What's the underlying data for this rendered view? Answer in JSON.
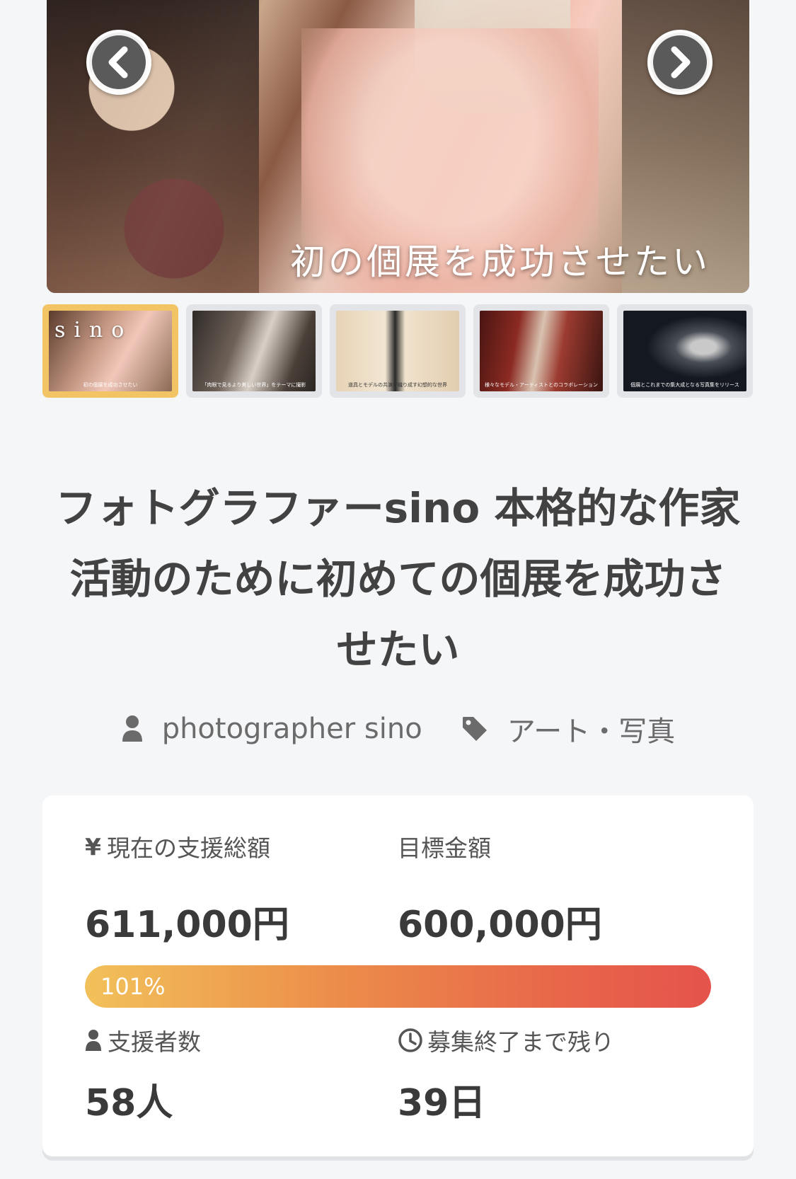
{
  "hero": {
    "caption": "初の個展を成功させたい",
    "prev_label": "‹",
    "next_label": "›"
  },
  "thumbnails": [
    {
      "logo": "sino",
      "caption": "初の個展を成功させたい",
      "active": true
    },
    {
      "caption": "「肉眼で見るより美しい世界」をテーマに撮影",
      "active": false
    },
    {
      "caption": "道具とモデルの共演が織り成す幻想的な世界",
      "active": false
    },
    {
      "caption": "様々なモデル・アーティストとのコラボレーション",
      "active": false
    },
    {
      "caption": "個展とこれまでの集大成となる写真集をリリース",
      "active": false
    }
  ],
  "project": {
    "title": "フォトグラファーsino 本格的な作家活動のために初めての個展を成功させたい",
    "author": "photographer sino",
    "category": "アート・写真"
  },
  "stats": {
    "current_label": "現在の支援総額",
    "current_value": "611,000円",
    "goal_label": "目標金額",
    "goal_value": "600,000円",
    "progress_percent": 101,
    "progress_text": "101%",
    "backers_label": "支援者数",
    "backers_value": "58人",
    "remaining_label": "募集終了まで残り",
    "remaining_value": "39日"
  },
  "colors": {
    "progress_start": "#f2c15a",
    "progress_end": "#e5534b",
    "active_thumb_border": "#f3c463",
    "background": "#f5f6f8"
  },
  "icons": [
    "chevron-left-icon",
    "chevron-right-icon",
    "user-icon",
    "tag-icon",
    "yen-icon",
    "clock-icon"
  ]
}
